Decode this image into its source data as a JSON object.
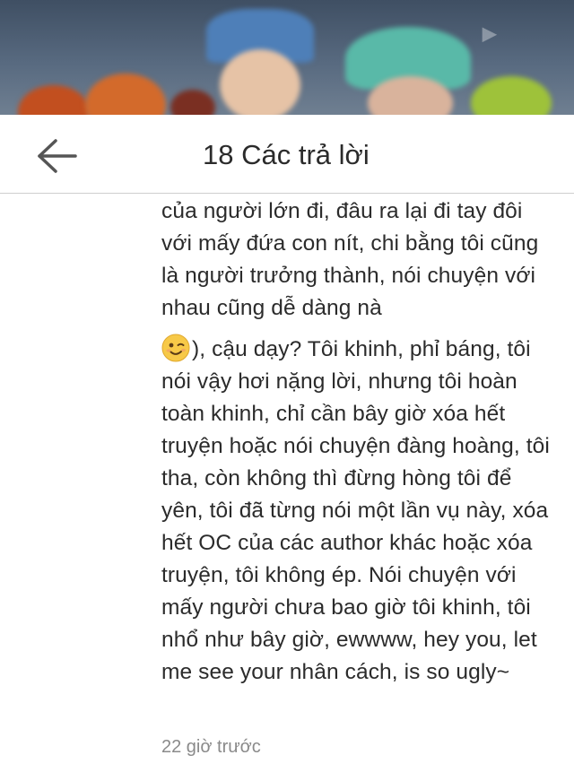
{
  "header": {
    "title": "18 Các trả lời",
    "back_icon": "arrow-left-icon"
  },
  "comment": {
    "paragraph_1": "của người lớn đi, đâu ra lại đi tay đôi với mấy đứa con nít, chi bằng tôi cũng là người trưởng thành, nói chuyện với nhau cũng dễ dàng nà",
    "emoji": "winking-face-icon",
    "paragraph_2": "), cậu dạy? Tôi khinh, phỉ báng, tôi nói vậy hơi nặng lời, nhưng tôi hoàn toàn khinh, chỉ cần bây giờ xóa hết truyện hoặc nói chuyện đàng hoàng, tôi tha, còn không thì đừng hòng tôi để yên, tôi đã từng nói một lần vụ này, xóa hết OC của các author khác hoặc xóa truyện, tôi không ép. Nói chuyện với mấy người chưa bao giờ tôi khinh, tôi nhổ như bây giờ, ewwww, hey you, let me see your nhân cách, is so ugly~",
    "timestamp": "22 giờ trước"
  },
  "colors": {
    "text": "#2b2b2b",
    "muted": "#8a8a8a",
    "divider": "#cfcfcf"
  }
}
